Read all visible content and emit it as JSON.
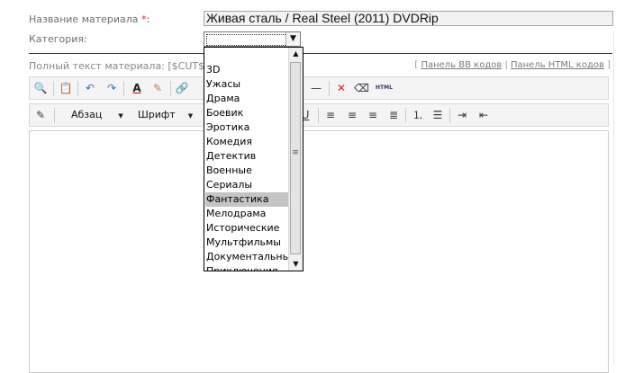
{
  "form": {
    "title_label": "Название материала",
    "required_mark": "*:",
    "title_value": "Живая сталь / Real Steel (2011) DVDRip",
    "category_label": "Категория:",
    "category_value": ""
  },
  "fulltext": {
    "label": "Полный текст материала: [$CUT$ ",
    "help": "?",
    "label_end": "]"
  },
  "panel_links": {
    "open": "[ ",
    "bb": "Панель BB кодов",
    "sep": " | ",
    "html": "Панель HTML кодов",
    "close": " ]"
  },
  "toolbar": {
    "paragraph": "Абзац",
    "font": "Шрифт",
    "html_badge": "HTML"
  },
  "dropdown": {
    "options": [
      "3D",
      "Ужасы",
      "Драма",
      "Боевик",
      "Эротика",
      "Комедия",
      "Детектив",
      "Военные",
      "Сериалы",
      "Фантастика",
      "Мелодрама",
      "Исторические",
      "Мультфильмы",
      "Документальные",
      "Приключения"
    ],
    "selected": "Фантастика"
  },
  "icons": {
    "preview": "magnifier-icon",
    "paste": "paste-icon",
    "undo": "undo-icon",
    "redo": "redo-icon",
    "text_color": "text-color-icon",
    "bg_color": "background-color-icon",
    "link": "link-icon",
    "hr": "horizontal-rule-icon",
    "remove_format": "remove-format-icon",
    "eraser": "eraser-icon",
    "html": "html-icon",
    "edit": "edit-icon",
    "underline": "underline-icon",
    "align": [
      "align-left-icon",
      "align-center-icon",
      "align-right-icon",
      "align-justify-icon"
    ],
    "lists": [
      "ordered-list-icon",
      "unordered-list-icon"
    ],
    "indent": [
      "indent-icon",
      "outdent-icon"
    ]
  }
}
